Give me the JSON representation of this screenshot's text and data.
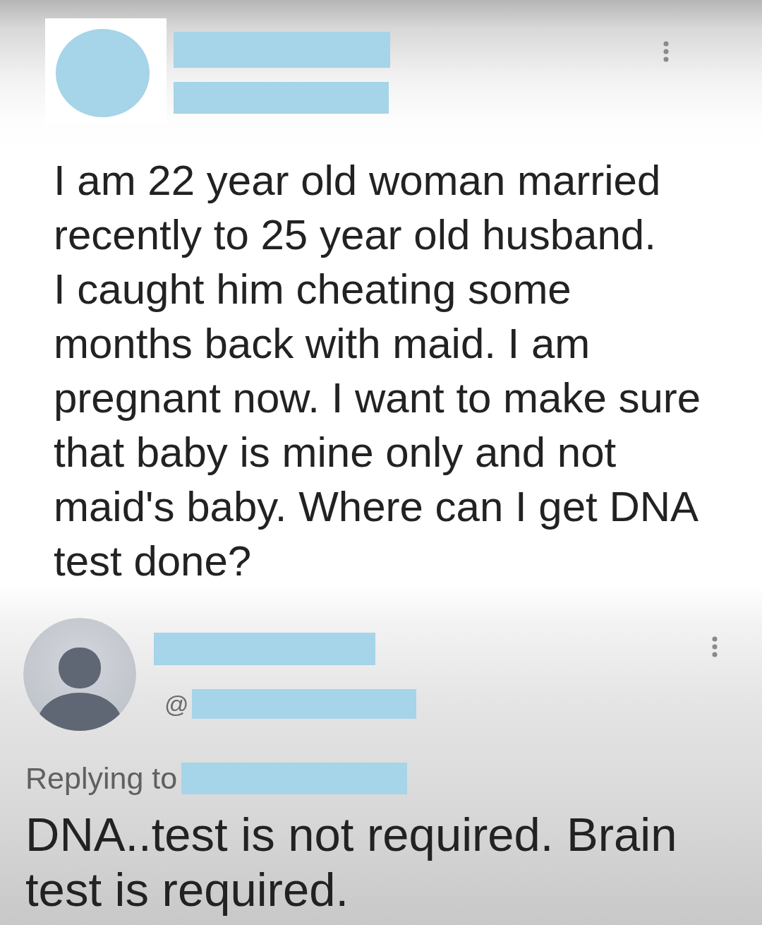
{
  "post": {
    "text": "I am 22 year old woman married\nrecently to 25 year old husband.\nI caught him cheating some\nmonths back with maid. I am\npregnant now. I want to make sure\nthat baby is mine only and not\nmaid's baby. Where can I get DNA\ntest done?"
  },
  "reply": {
    "handle_prefix": "@",
    "replying_to_label": "Replying to",
    "text": "DNA..test is not required. Brain test is required."
  }
}
